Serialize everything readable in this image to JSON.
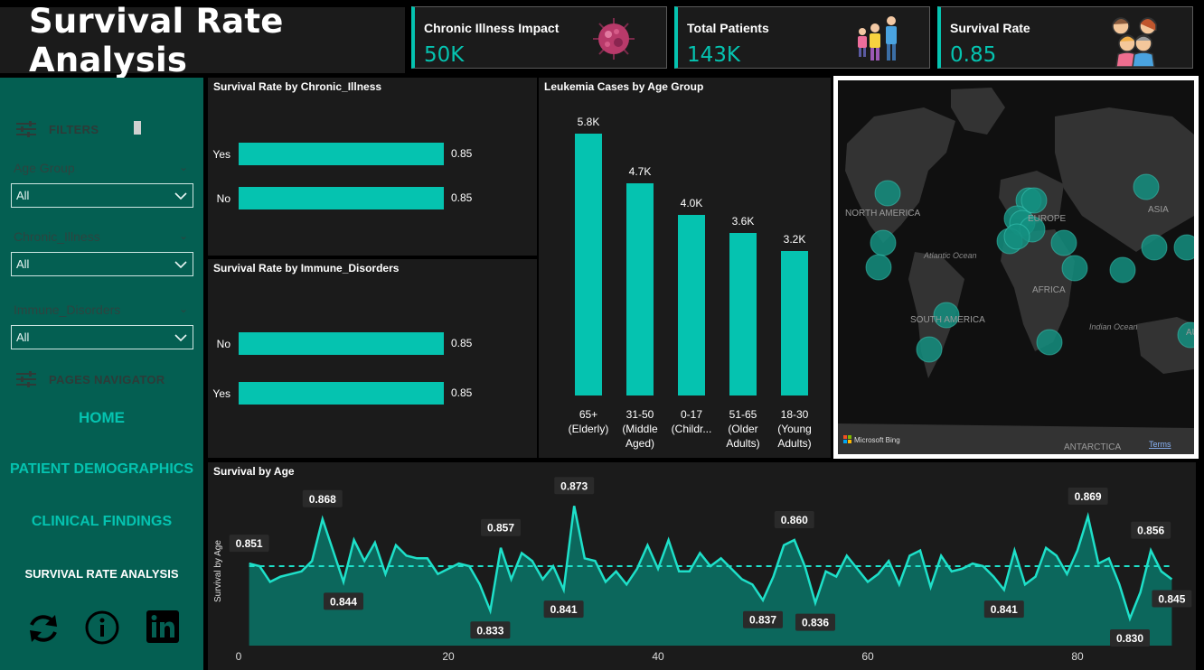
{
  "title": "Survival Rate Analysis",
  "kpis": [
    {
      "label": "Chronic Illness Impact",
      "value": "50K",
      "icon": "virus-icon"
    },
    {
      "label": "Total Patients",
      "value": "143K",
      "icon": "family-icon"
    },
    {
      "label": "Survival Rate",
      "value": "0.85",
      "icon": "group-icon"
    }
  ],
  "sidebar": {
    "filters_label": "FILTERS",
    "filters": [
      {
        "label": "Age Group",
        "value": "All"
      },
      {
        "label": "Chronic_Illness",
        "value": "All"
      },
      {
        "label": "Immune_Disorders",
        "value": "All"
      }
    ],
    "nav_label": "PAGES NAVIGATOR",
    "nav": [
      "HOME",
      "PATIENT DEMOGRAPHICS",
      "CLINICAL FINDINGS",
      "SURVIVAL RATE ANALYSIS"
    ],
    "footer_icons": [
      "refresh-icon",
      "info-icon",
      "linkedin-icon"
    ]
  },
  "map": {
    "labels": [
      "NORTH AMERICA",
      "EUROPE",
      "ASIA",
      "Atlantic Ocean",
      "AFRICA",
      "SOUTH AMERICA",
      "Indian Ocean",
      "ANTARCTICA",
      "AU"
    ],
    "attribution": "Microsoft Bing",
    "terms": "Terms"
  },
  "chart_data": [
    {
      "type": "bar",
      "orientation": "horizontal",
      "title": "Survival Rate by Chronic_Illness",
      "categories": [
        "Yes",
        "No"
      ],
      "values": [
        0.85,
        0.85
      ],
      "data_labels": [
        "0.85",
        "0.85"
      ]
    },
    {
      "type": "bar",
      "orientation": "horizontal",
      "title": "Survival Rate by Immune_Disorders",
      "categories": [
        "No",
        "Yes"
      ],
      "values": [
        0.85,
        0.85
      ],
      "data_labels": [
        "0.85",
        "0.85"
      ]
    },
    {
      "type": "bar",
      "orientation": "vertical",
      "title": "Leukemia Cases by Age Group",
      "categories": [
        [
          "65+",
          "(Elderly)"
        ],
        [
          "31-50",
          "(Middle",
          "Aged)"
        ],
        [
          "0-17",
          "(Childr..."
        ],
        [
          "51-65",
          "(Older",
          "Adults)"
        ],
        [
          "18-30",
          "(Young",
          "Adults)"
        ]
      ],
      "values": [
        5800,
        4700,
        4000,
        3600,
        3200
      ],
      "data_labels": [
        "5.8K",
        "4.7K",
        "4.0K",
        "3.6K",
        "3.2K"
      ]
    },
    {
      "type": "area",
      "title": "Survival by Age",
      "ylabel": "Survival by Age",
      "xticks": [
        "0",
        "20",
        "40",
        "60",
        "80"
      ],
      "average": 0.85,
      "x": [
        1,
        2,
        3,
        4,
        5,
        6,
        7,
        8,
        9,
        10,
        11,
        12,
        13,
        14,
        15,
        16,
        17,
        18,
        19,
        20,
        21,
        22,
        23,
        24,
        25,
        26,
        27,
        28,
        29,
        30,
        31,
        32,
        33,
        34,
        35,
        36,
        37,
        38,
        39,
        40,
        41,
        42,
        43,
        44,
        45,
        46,
        47,
        48,
        49,
        50,
        51,
        52,
        53,
        54,
        55,
        56,
        57,
        58,
        59,
        60,
        61,
        62,
        63,
        64,
        65,
        66,
        67,
        68,
        69,
        70,
        71,
        72,
        73,
        74,
        75,
        76,
        77,
        78,
        79,
        80,
        81,
        82,
        83,
        84,
        85,
        86,
        87,
        88,
        89
      ],
      "y": [
        0.851,
        0.85,
        0.844,
        0.846,
        0.847,
        0.848,
        0.852,
        0.868,
        0.856,
        0.844,
        0.86,
        0.852,
        0.859,
        0.847,
        0.858,
        0.854,
        0.853,
        0.853,
        0.847,
        0.849,
        0.851,
        0.85,
        0.843,
        0.833,
        0.857,
        0.845,
        0.855,
        0.852,
        0.845,
        0.85,
        0.841,
        0.873,
        0.853,
        0.852,
        0.844,
        0.848,
        0.843,
        0.849,
        0.858,
        0.849,
        0.86,
        0.848,
        0.848,
        0.855,
        0.85,
        0.853,
        0.849,
        0.845,
        0.843,
        0.837,
        0.846,
        0.858,
        0.86,
        0.85,
        0.836,
        0.848,
        0.846,
        0.854,
        0.849,
        0.844,
        0.847,
        0.852,
        0.843,
        0.854,
        0.856,
        0.842,
        0.854,
        0.848,
        0.849,
        0.851,
        0.85,
        0.846,
        0.841,
        0.856,
        0.843,
        0.846,
        0.857,
        0.854,
        0.847,
        0.856,
        0.869,
        0.851,
        0.853,
        0.843,
        0.83,
        0.84,
        0.856,
        0.848,
        0.845
      ],
      "point_labels": [
        {
          "x": 1,
          "text": "0.851"
        },
        {
          "x": 8,
          "text": "0.868"
        },
        {
          "x": 10,
          "text": "0.844"
        },
        {
          "x": 24,
          "text": "0.833"
        },
        {
          "x": 25,
          "text": "0.857"
        },
        {
          "x": 31,
          "text": "0.841"
        },
        {
          "x": 32,
          "text": "0.873"
        },
        {
          "x": 50,
          "text": "0.837"
        },
        {
          "x": 53,
          "text": "0.860"
        },
        {
          "x": 55,
          "text": "0.836"
        },
        {
          "x": 73,
          "text": "0.841"
        },
        {
          "x": 81,
          "text": "0.869"
        },
        {
          "x": 85,
          "text": "0.830"
        },
        {
          "x": 87,
          "text": "0.856"
        },
        {
          "x": 89,
          "text": "0.845"
        }
      ]
    }
  ],
  "colors": {
    "accent": "#05c3b0",
    "sidebar": "#045f52",
    "panel": "#1b1b1b"
  }
}
